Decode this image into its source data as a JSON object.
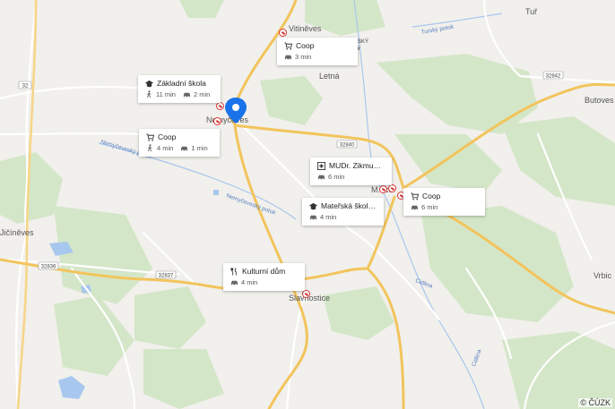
{
  "places": {
    "vitineves": "Vitiněves",
    "letna": "Letná",
    "nemyceves": "Nemyčeves",
    "jicineves": "Jičíněves",
    "slavhostice": "Slavhostice",
    "tur": "Tuř",
    "butoves": "Butoves",
    "vrbice": "Vrbic",
    "spsky": "VSKÝ",
    "spsky2": "W",
    "m_se": "M...ce"
  },
  "water": {
    "nemyceves_potok_1": "Nemyčeveský potok",
    "nemyceves_potok_2": "Nemyčeveský potok",
    "tursky_potok": "Turský potok",
    "cidlina_1": "Cidlina",
    "cidlina_2": "Cidlina"
  },
  "roads": {
    "r32": "32",
    "r32842": "32842",
    "r32840": "32840",
    "r32836": "32836",
    "r32837": "32837"
  },
  "pois": [
    {
      "title": "Coop",
      "icon": "cart-icon",
      "times": [
        {
          "mode": "car-icon",
          "value": "3 min"
        }
      ]
    },
    {
      "title": "Základní škola",
      "icon": "school-icon",
      "times": [
        {
          "mode": "walk-icon",
          "value": "11 min"
        },
        {
          "mode": "car-icon",
          "value": "2 min"
        }
      ]
    },
    {
      "title": "Coop",
      "icon": "cart-icon",
      "times": [
        {
          "mode": "walk-icon",
          "value": "4 min"
        },
        {
          "mode": "car-icon",
          "value": "1 min"
        }
      ]
    },
    {
      "title": "MUDr. Zikmund Z...",
      "icon": "medical-icon",
      "times": [
        {
          "mode": "car-icon",
          "value": "6 min"
        }
      ]
    },
    {
      "title": "Mateřská škola M...",
      "icon": "school-icon",
      "times": [
        {
          "mode": "car-icon",
          "value": "4 min"
        }
      ]
    },
    {
      "title": "Coop",
      "icon": "cart-icon",
      "times": [
        {
          "mode": "car-icon",
          "value": "6 min"
        }
      ]
    },
    {
      "title": "Kulturní dům",
      "icon": "fork-knife-icon",
      "times": [
        {
          "mode": "car-icon",
          "value": "4 min"
        }
      ]
    }
  ],
  "copyright": "© ČÚZK",
  "colors": {
    "pin": "#1a73e8",
    "forest": "#d3e8c6",
    "water": "#aac8ef",
    "road_major": "#f5cc6a",
    "road_minor": "#ffffff"
  }
}
